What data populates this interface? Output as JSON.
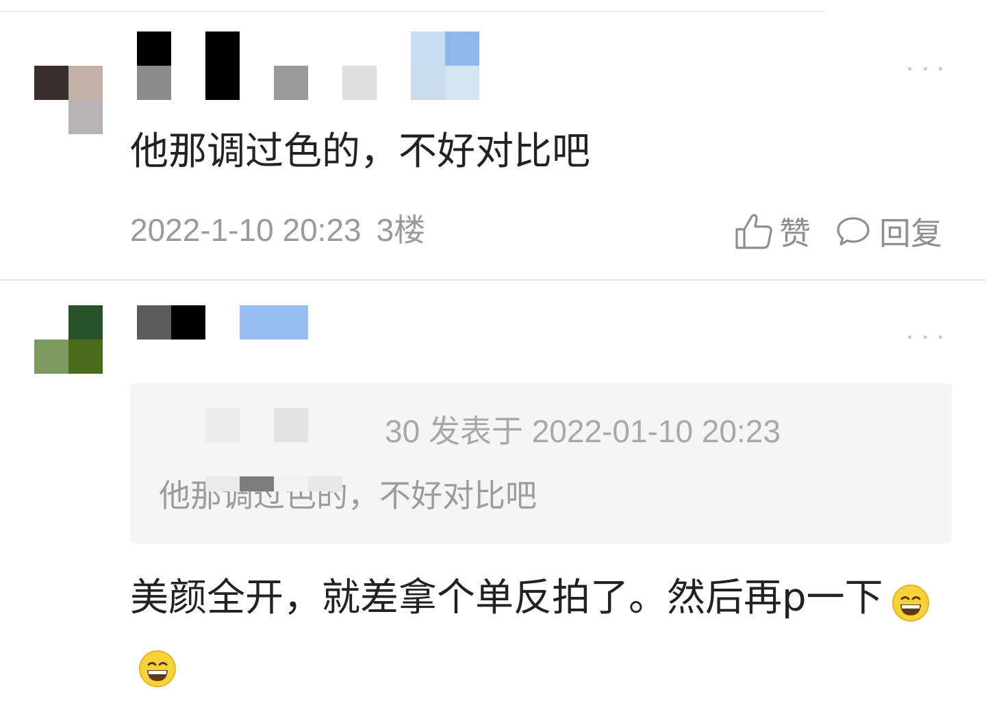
{
  "comments": [
    {
      "text": "他那调过色的，不好对比吧",
      "time": "2022-1-10 20:23",
      "floor": "3楼",
      "like_label": "赞",
      "reply_label": "回复"
    },
    {
      "quote": {
        "meta": "30 发表于 2022-01-10 20:23",
        "text": "他那调过色的，不好对比吧"
      },
      "text": "美颜全开，就差拿个单反拍了。然后再p一下",
      "emojis": [
        "grinning-face-emoji",
        "grinning-face-emoji"
      ]
    }
  ],
  "icons": {
    "more": "more-dots-icon",
    "like": "thumbs-up-icon",
    "reply": "speech-bubble-icon"
  },
  "colors": {
    "text_primary": "#222222",
    "text_secondary": "#9a9a9a",
    "quote_bg": "#f5f5f5",
    "divider": "#e6e6e6"
  }
}
